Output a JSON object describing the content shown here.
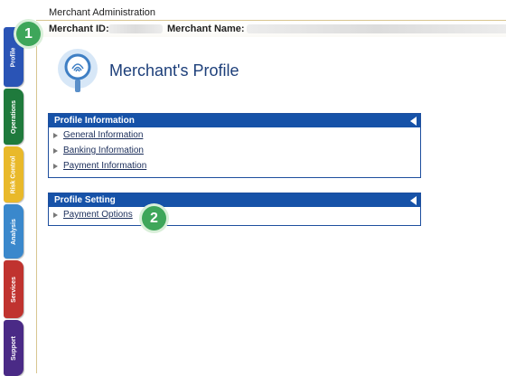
{
  "header": {
    "app_title": "Merchant Administration",
    "merchant_id_label": "Merchant ID:",
    "merchant_name_label": "Merchant Name:"
  },
  "tabs": [
    {
      "label": "Profile",
      "color": "#2a54b6"
    },
    {
      "label": "Operations",
      "color": "#1f7a3c"
    },
    {
      "label": "Risk Control",
      "color": "#e9b92a"
    },
    {
      "label": "Analysis",
      "color": "#3a88cc"
    },
    {
      "label": "Services",
      "color": "#c0332f"
    },
    {
      "label": "Support",
      "color": "#4a2a86"
    }
  ],
  "badges": [
    "1",
    "2"
  ],
  "page": {
    "title": "Merchant's Profile",
    "icon": "fingerprint-search-icon"
  },
  "panels": [
    {
      "title": "Profile Information",
      "links": [
        "General Information",
        "Banking Information",
        "Payment Information"
      ]
    },
    {
      "title": "Profile Setting",
      "links": [
        "Payment Options"
      ]
    }
  ],
  "colors": {
    "accent": "#1652a8",
    "badge": "#3ea65a",
    "rule": "#d8c590"
  }
}
